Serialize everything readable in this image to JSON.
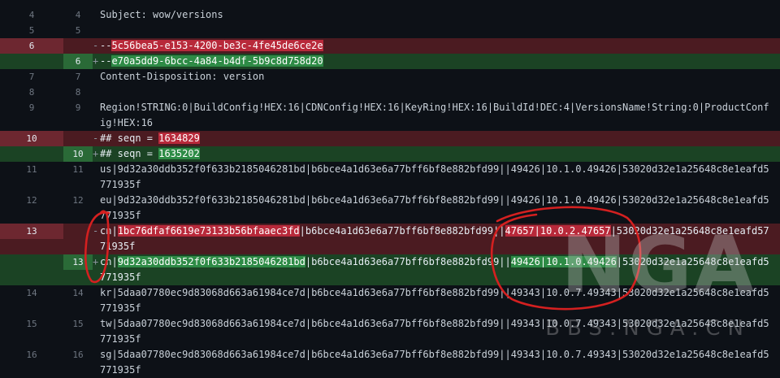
{
  "colors": {
    "background": "#0d1117",
    "deleted_line": "#4b1b21",
    "added_line": "#1b4324",
    "deleted_highlight": "#b8293a",
    "added_highlight": "#2e8b46",
    "annotation_red": "#d42020"
  },
  "diff": {
    "rows": [
      {
        "old": "4",
        "new": "4",
        "mark": "",
        "text": "Subject: wow/versions"
      },
      {
        "old": "5",
        "new": "5",
        "mark": "",
        "text": ""
      },
      {
        "old": "6",
        "new": "",
        "mark": "-",
        "pre": "--",
        "hl": "5c56bea5-e153-4200-be3c-4fe45de6ce2e",
        "post": ""
      },
      {
        "old": "",
        "new": "6",
        "mark": "+",
        "pre": "--",
        "hl": "e70a5dd9-6bcc-4a84-b4df-5b9c8d758d20",
        "post": ""
      },
      {
        "old": "7",
        "new": "7",
        "mark": "",
        "text": "Content-Disposition: version"
      },
      {
        "old": "8",
        "new": "8",
        "mark": "",
        "text": ""
      },
      {
        "old": "9",
        "new": "9",
        "mark": "",
        "text": "Region!STRING:0|BuildConfig!HEX:16|CDNConfig!HEX:16|KeyRing!HEX:16|BuildId!DEC:4|VersionsName!String:0|ProductConfig!HEX:16"
      },
      {
        "old": "10",
        "new": "",
        "mark": "-",
        "pre": "## seqn = ",
        "hl": "1634829",
        "post": ""
      },
      {
        "old": "",
        "new": "10",
        "mark": "+",
        "pre": "## seqn = ",
        "hl": "1635202",
        "post": ""
      },
      {
        "old": "11",
        "new": "11",
        "mark": "",
        "text": "us|9d32a30ddb352f0f633b2185046281bd|b6bce4a1d63e6a77bff6bf8e882bfd99||49426|10.1.0.49426|53020d32e1a25648c8e1eafd5771935f"
      },
      {
        "old": "12",
        "new": "12",
        "mark": "",
        "text": "eu|9d32a30ddb352f0f633b2185046281bd|b6bce4a1d63e6a77bff6bf8e882bfd99||49426|10.1.0.49426|53020d32e1a25648c8e1eafd5771935f"
      },
      {
        "old": "13",
        "new": "",
        "mark": "-",
        "pre": "cn|",
        "hl": "1bc76dfaf6619e73133b56bfaaec3fd",
        "mid": "|b6bce4a1d63e6a77bff6bf8e882bfd99||",
        "hl2": "47657|10.0.2.47657",
        "post": "|53020d32e1a25648c8e1eafd5771935f"
      },
      {
        "old": "",
        "new": "13",
        "mark": "+",
        "pre": "cn|",
        "hl": "9d32a30ddb352f0f633b2185046281bd",
        "mid": "|b6bce4a1d63e6a77bff6bf8e882bfd99||",
        "hl2": "49426|10.1.0.49426",
        "post": "|53020d32e1a25648c8e1eafd5771935f"
      },
      {
        "old": "14",
        "new": "14",
        "mark": "",
        "text": "kr|5daa07780ec9d83068d663a61984ce7d|b6bce4a1d63e6a77bff6bf8e882bfd99||49343|10.0.7.49343|53020d32e1a25648c8e1eafd5771935f"
      },
      {
        "old": "15",
        "new": "15",
        "mark": "",
        "text": "tw|5daa07780ec9d83068d663a61984ce7d|b6bce4a1d63e6a77bff6bf8e882bfd99||49343|10.0.7.49343|53020d32e1a25648c8e1eafd5771935f"
      },
      {
        "old": "16",
        "new": "16",
        "mark": "",
        "text": "sg|5daa07780ec9d83068d663a61984ce7d|b6bce4a1d63e6a77bff6bf8e882bfd99||49343|10.0.7.49343|53020d32e1a25648c8e1eafd5771935f"
      }
    ]
  },
  "watermark": {
    "logo": "NGA",
    "site": "BBS.NGA.CN"
  }
}
